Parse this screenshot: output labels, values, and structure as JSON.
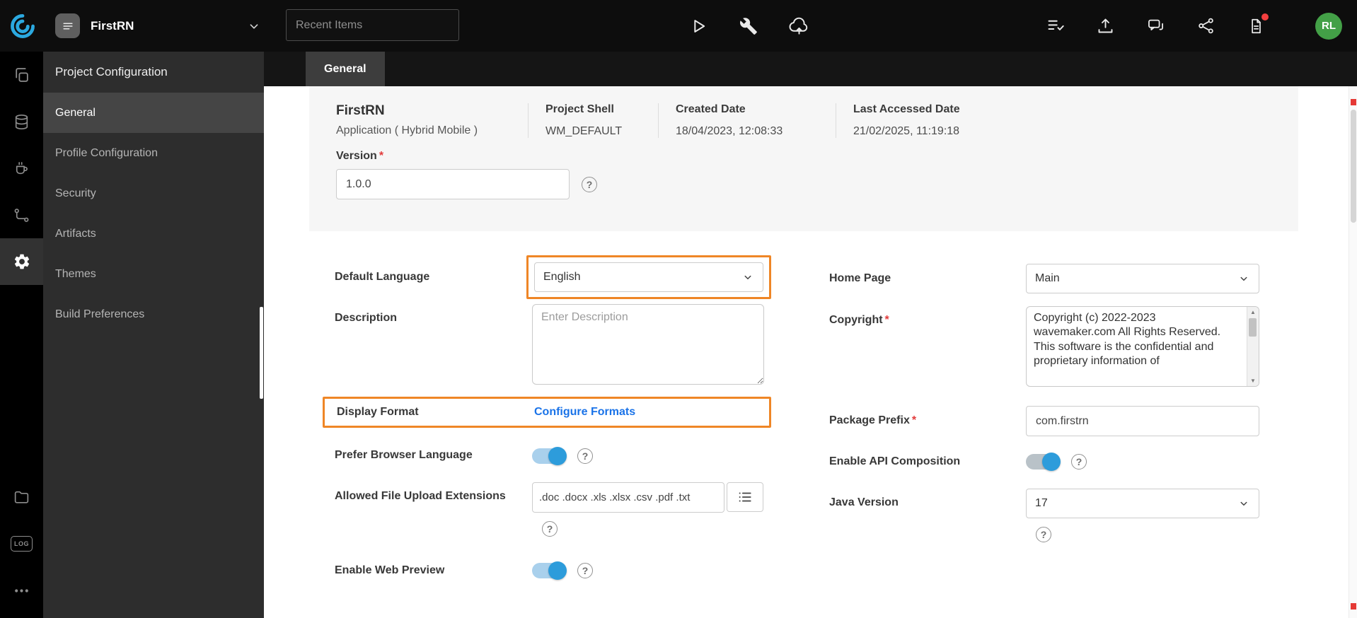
{
  "icons": {
    "question_glyph": "?",
    "required_marker": "*",
    "scroll_up_glyph": "▲",
    "scroll_down_glyph": "▼",
    "log_label": "LOG"
  },
  "topbar": {
    "project_name": "FirstRN",
    "recent_items_placeholder": "Recent Items",
    "avatar_initials": "RL"
  },
  "sidebar": {
    "title": "Project Configuration",
    "items": [
      {
        "label": "General",
        "active": true
      },
      {
        "label": "Profile Configuration",
        "active": false
      },
      {
        "label": "Security",
        "active": false
      },
      {
        "label": "Artifacts",
        "active": false
      },
      {
        "label": "Themes",
        "active": false
      },
      {
        "label": "Build Preferences",
        "active": false
      }
    ]
  },
  "tabs": [
    {
      "label": "General",
      "active": true
    }
  ],
  "summary": {
    "project_name": "FirstRN",
    "project_type": "Application ( Hybrid Mobile )",
    "columns": [
      {
        "label": "Project Shell",
        "value": "WM_DEFAULT"
      },
      {
        "label": "Created Date",
        "value": "18/04/2023, 12:08:33"
      },
      {
        "label": "Last Accessed Date",
        "value": "21/02/2025, 11:19:18"
      }
    ],
    "version": {
      "label": "Version",
      "required": true,
      "value": "1.0.0"
    }
  },
  "form": {
    "default_language": {
      "label": "Default Language",
      "value": "English",
      "highlighted": true
    },
    "home_page": {
      "label": "Home Page",
      "value": "Main"
    },
    "description": {
      "label": "Description",
      "placeholder": "Enter Description",
      "value": ""
    },
    "copyright": {
      "label": "Copyright",
      "required": true,
      "value": "Copyright (c) 2022-2023 wavemaker.com All Rights Reserved.  This software is the confidential and proprietary information of"
    },
    "display_format": {
      "label": "Display Format",
      "link": "Configure Formats",
      "highlighted": true
    },
    "package_prefix": {
      "label": "Package Prefix",
      "required": true,
      "value": "com.firstrn"
    },
    "prefer_browser_language": {
      "label": "Prefer Browser Language",
      "on": true
    },
    "enable_api_composition": {
      "label": "Enable API Composition",
      "on": true
    },
    "allowed_file_upload_extensions": {
      "label": "Allowed File Upload Extensions",
      "value": ".doc .docx .xls .xlsx .csv .pdf .txt"
    },
    "java_version": {
      "label": "Java Version",
      "value": "17"
    },
    "enable_web_preview": {
      "label": "Enable Web Preview",
      "on": true
    }
  },
  "colors": {
    "accent_orange": "#EF8626",
    "toggle_blue": "#2D9CDB",
    "link_blue": "#1A73E8",
    "required_red": "#E23B3B",
    "avatar_green": "#43A047"
  }
}
